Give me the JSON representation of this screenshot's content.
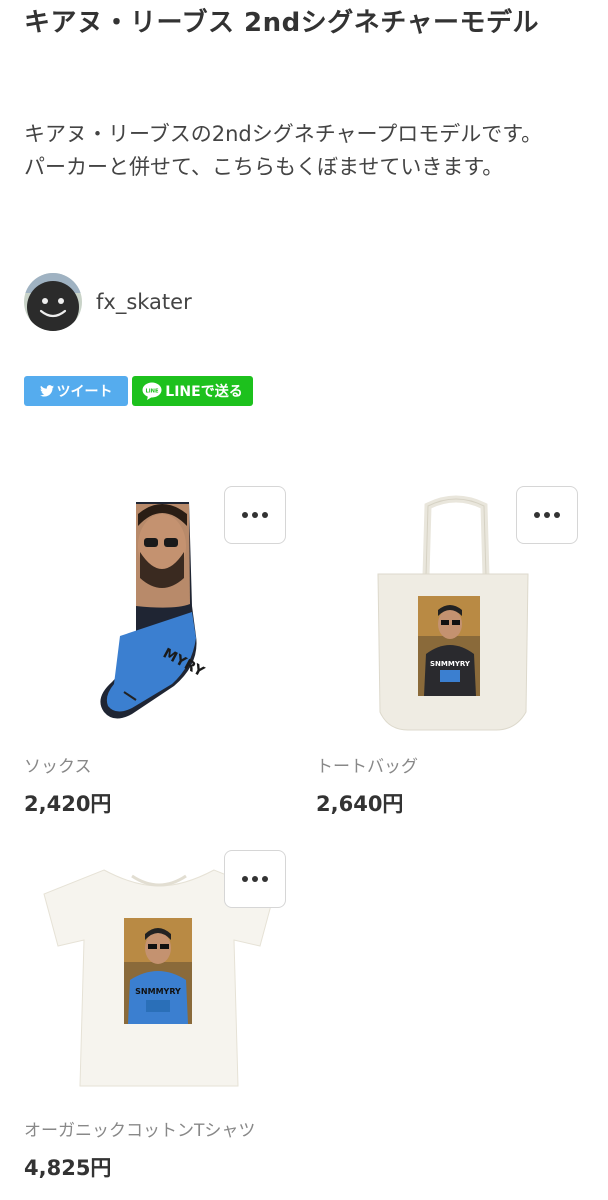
{
  "page": {
    "title": "キアヌ・リーブス 2ndシグネチャーモデル",
    "description_line1": "キアヌ・リーブスの2ndシグネチャープロモデルです。",
    "description_line2": "パーカーと併せて、こちらもくぼませていきます。"
  },
  "author": {
    "name": "fx_skater",
    "avatar_icon": "smiley-avatar-icon"
  },
  "share": {
    "tweet_label": "ツイート",
    "line_label": "LINEで送る",
    "twitter_color": "#55acee",
    "line_color": "#1dc11d"
  },
  "products": [
    {
      "name": "ソックス",
      "price": "2,420円",
      "icon": "socks-image"
    },
    {
      "name": "トートバッグ",
      "price": "2,640円",
      "icon": "tote-bag-image"
    },
    {
      "name": "オーガニックコットンTシャツ",
      "price": "4,825円",
      "icon": "tshirt-image"
    }
  ],
  "more_icon": "more-dots-icon"
}
